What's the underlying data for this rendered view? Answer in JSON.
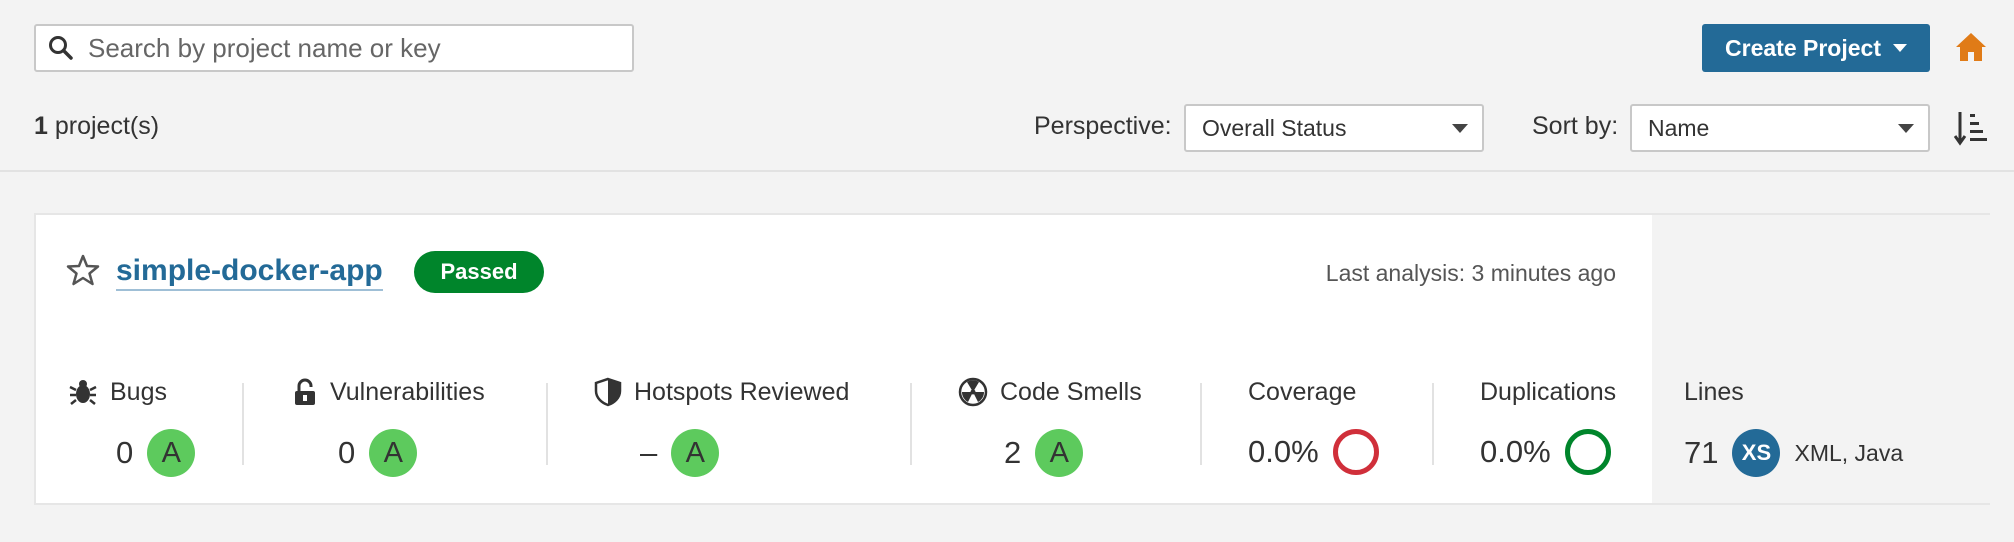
{
  "search": {
    "placeholder": "Search by project name or key"
  },
  "header": {
    "create_label": "Create Project",
    "count": "1",
    "count_suffix": "project(s)",
    "perspective_label": "Perspective:",
    "perspective_value": "Overall Status",
    "sort_label": "Sort by:",
    "sort_value": "Name"
  },
  "project": {
    "name": "simple-docker-app",
    "status": "Passed",
    "last_analysis": "Last analysis: 3 minutes ago",
    "metrics": {
      "bugs": {
        "label": "Bugs",
        "value": "0",
        "rating": "A"
      },
      "vulnerabilities": {
        "label": "Vulnerabilities",
        "value": "0",
        "rating": "A"
      },
      "hotspots": {
        "label": "Hotspots Reviewed",
        "value": "–",
        "rating": "A"
      },
      "code_smells": {
        "label": "Code Smells",
        "value": "2",
        "rating": "A"
      },
      "coverage": {
        "label": "Coverage",
        "value": "0.0%"
      },
      "duplications": {
        "label": "Duplications",
        "value": "0.0%"
      },
      "lines": {
        "label": "Lines",
        "value": "71",
        "size": "XS",
        "languages": "XML, Java"
      }
    }
  },
  "colors": {
    "brand_blue": "#236a97",
    "passed_green": "#00852b",
    "rating_a": "#5dca5d",
    "coverage_red": "#d02f3a",
    "home_orange": "#e07b17"
  }
}
